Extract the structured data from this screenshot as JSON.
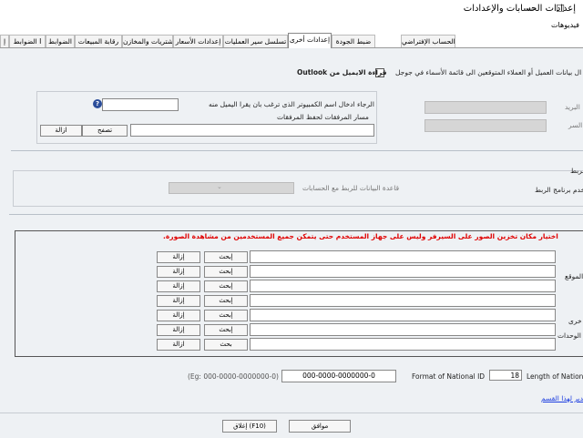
{
  "window": {
    "title": "إعدادات الحسابات والإعدادات",
    "minimize": "—",
    "maximize": "☐"
  },
  "menu": {
    "item": "فيديوهات"
  },
  "tabs": [
    {
      "label": "الحساب الإفتراضي"
    },
    {
      "label": "ضبط الجودة"
    },
    {
      "label": "إعدادات أخرى"
    },
    {
      "label": "تسلسل سير العمليات"
    },
    {
      "label": "إعدادات الأسعار"
    },
    {
      "label": "المشتريات والمخازن"
    },
    {
      "label": "رقابة المبيعات"
    },
    {
      "label": "الضوابط"
    },
    {
      "label": "الضوابط I"
    },
    {
      "label": "إ"
    }
  ],
  "top": {
    "outlook_label": "قراءة الايميل من Outlook",
    "google_label": "ال بيانات العميل أو العملاء المتوقعين الى قائمة الأسماء في جوجل"
  },
  "email": {
    "computer_prompt": "الرجاء ادخال اسم الكمبيوتر الذى ترغب بان يقرا اليميل منه",
    "attachments_label": "مسار المرفقات لحفظ المرفقات",
    "browse": "تصفح",
    "remove": "ازالة",
    "mail_label": "البريد",
    "password_label": "السر",
    "help_icon": "help-icon"
  },
  "link_section": {
    "title": "الربط",
    "program_label": "ستخدم برنامج الربط",
    "db_label": "قاعدة البيانات للربط مع الحسابات"
  },
  "images": {
    "notice": "اختيار مكان تخزين الصور على السيرفر وليس على جهاز المستخدم حتى يتمكن جميع المستخدمين من مشاهدة الصورة.",
    "rows": [
      {
        "label": "",
        "browse": "إبحث",
        "remove": "إزالة"
      },
      {
        "label": "",
        "browse": "إبحث",
        "remove": "إزالة"
      },
      {
        "label": "الموقع",
        "browse": "إبحث",
        "remove": "إزالة"
      },
      {
        "label": "",
        "browse": "إبحث",
        "remove": "إزالة"
      },
      {
        "label": "",
        "browse": "إبحث",
        "remove": "إزالة"
      },
      {
        "label": "خرى",
        "browse": "إبحث",
        "remove": "إزالة"
      },
      {
        "label": "الوحدات",
        "browse": "بحث",
        "remove": "ازالة"
      }
    ]
  },
  "national": {
    "example": "(Eg: 000-0000-0000000-0)",
    "format_value": "000-0000-0000000-0",
    "format_label": "Format of National ID",
    "length_value": "18",
    "length_label": "Length of Nationa",
    "manage_link": "مدير لهذا القسم"
  },
  "footer": {
    "ok": "موافق",
    "close": "إغلاق (F10)"
  },
  "colors": {
    "background": "#eef1f4",
    "notice": "#e00000",
    "link": "#1a3ce0"
  }
}
